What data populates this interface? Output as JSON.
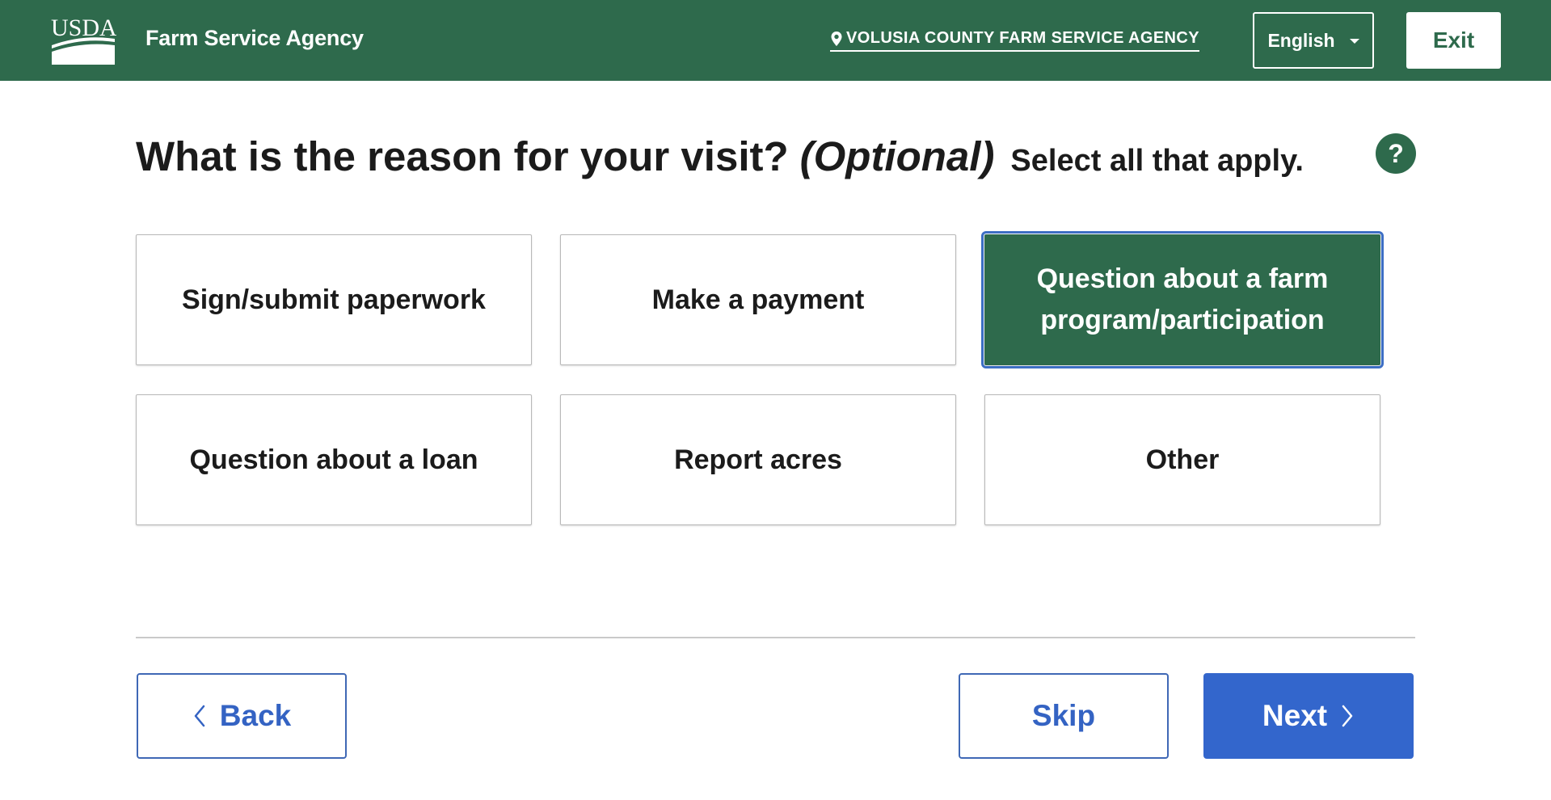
{
  "header": {
    "logo_text": "USDA",
    "agency_name": "Farm Service Agency",
    "location": "VOLUSIA COUNTY FARM SERVICE AGENCY",
    "language": "English",
    "exit_label": "Exit"
  },
  "question": {
    "title": "What is the reason for your visit?",
    "optional": "(Optional)",
    "hint": "Select all that apply.",
    "help_label": "?"
  },
  "options": [
    {
      "label": "Sign/submit paperwork",
      "selected": false
    },
    {
      "label": "Make a payment",
      "selected": false
    },
    {
      "label": "Question about a farm program/participation",
      "selected": true
    },
    {
      "label": "Question about a loan",
      "selected": false
    },
    {
      "label": "Report acres",
      "selected": false
    },
    {
      "label": "Other",
      "selected": false
    }
  ],
  "footer": {
    "back_label": "Back",
    "skip_label": "Skip",
    "next_label": "Next"
  },
  "colors": {
    "brand_green": "#2e6a4c",
    "primary_blue": "#3366cc",
    "selection_outline": "#3d6ec4"
  },
  "icons": {
    "logo": "usda-logo-icon",
    "location": "map-pin-icon",
    "language_dropdown": "caret-down-icon",
    "help": "question-mark-icon",
    "back": "chevron-left-icon",
    "next": "chevron-right-icon"
  }
}
